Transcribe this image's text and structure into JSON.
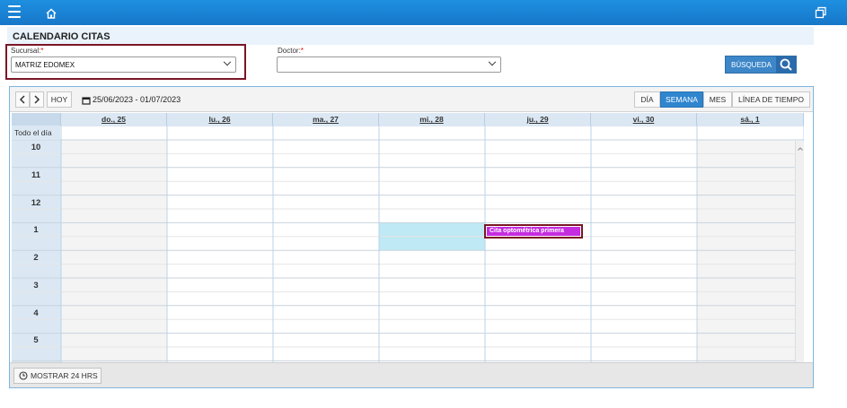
{
  "header": {
    "menu_icon": "menu-icon",
    "home_icon": "home-icon",
    "restore_icon": "window-restore-icon"
  },
  "page": {
    "title": "CALENDARIO CITAS"
  },
  "form": {
    "sucursal_label": "Sucursal:",
    "sucursal_required": "*",
    "sucursal_value": "MATRIZ EDOMEX",
    "doctor_label": "Doctor:",
    "doctor_required": "*",
    "doctor_value": "",
    "search_label": "BÚSQUEDA",
    "search_icon": "magnifier-icon"
  },
  "calendar": {
    "prev_icon": "chevron-left-icon",
    "next_icon": "chevron-right-icon",
    "today_label": "HOY",
    "date_range": "25/06/2023 - 01/07/2023",
    "views": [
      "DÍA",
      "SEMANA",
      "MES",
      "LÍNEA DE TIEMPO"
    ],
    "active_view": "SEMANA",
    "all_day_label": "Todo el día",
    "days": [
      "do., 25",
      "lu., 26",
      "ma., 27",
      "mi., 28",
      "ju., 29",
      "vi., 30",
      "sá., 1"
    ],
    "hours": [
      "10",
      "11",
      "12",
      "1",
      "2",
      "3",
      "4",
      "5"
    ],
    "event": {
      "title": "Cita optométrica primera",
      "day": "ju., 29",
      "hour": "1"
    },
    "selected_slot": {
      "day": "mi., 28",
      "hour": "12:30 - 1:30"
    },
    "show24_label": "MOSTRAR 24 HRS",
    "colors": {
      "accent": "#1777c9",
      "event": "#c52ce0",
      "selected": "#bfe9f4",
      "highlight": "#7a1626"
    }
  }
}
